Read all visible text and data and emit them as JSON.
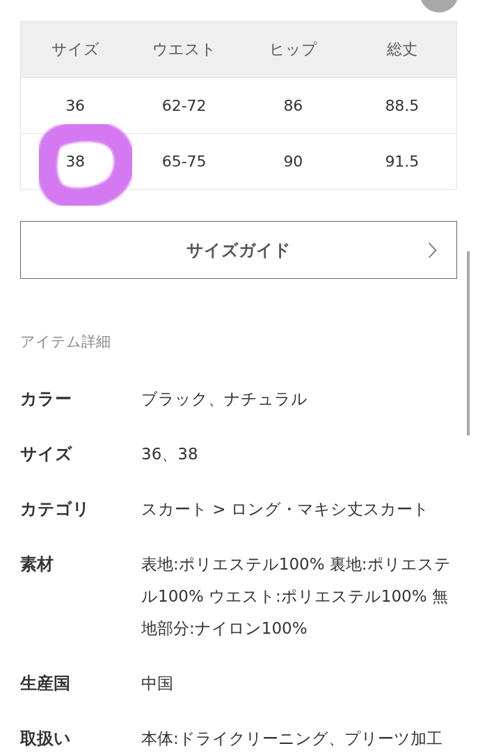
{
  "size_table": {
    "columns": [
      "サイズ",
      "ウエスト",
      "ヒップ",
      "総丈"
    ],
    "rows": [
      {
        "cells": [
          "36",
          "62-72",
          "86",
          "88.5"
        ],
        "circled": false
      },
      {
        "cells": [
          "38",
          "65-75",
          "90",
          "91.5"
        ],
        "circled": true
      }
    ]
  },
  "size_guide_button": {
    "label": "サイズガイド"
  },
  "item_details": {
    "title": "アイテム詳細",
    "rows": [
      {
        "label": "カラー",
        "value": "ブラック、ナチュラル"
      },
      {
        "label": "サイズ",
        "value": "36、38"
      },
      {
        "label": "カテゴリ",
        "value": "スカート > ロング・マキシ丈スカート"
      },
      {
        "label": "素材",
        "value": "表地:ポリエステル100% 裏地:ポリエステル100% ウエスト:ポリエステル100% 無地部分:ナイロン100%"
      },
      {
        "label": "生産国",
        "value": "中国"
      },
      {
        "label": "取扱い",
        "value": "本体:ドライクリーニング、プリーツ加工"
      }
    ]
  }
}
